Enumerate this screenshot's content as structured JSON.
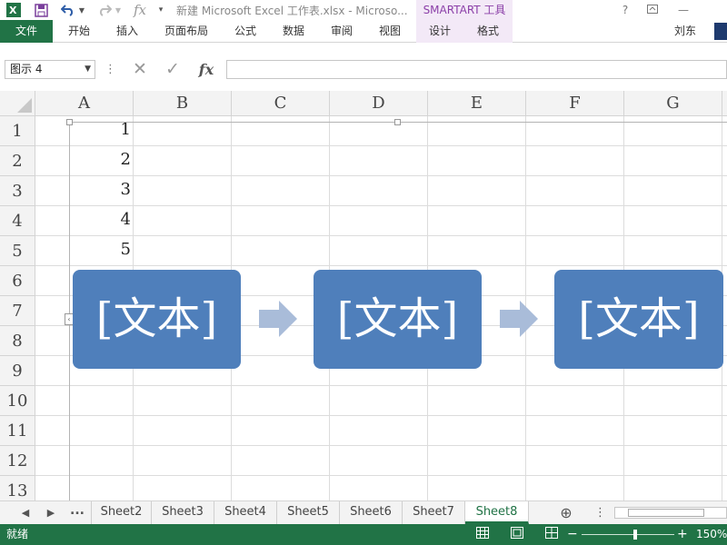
{
  "titlebar": {
    "title": "新建 Microsoft Excel 工作表.xlsx - Microso...",
    "context_group": "SMARTART 工具",
    "icons": [
      "excel-logo-icon",
      "save-icon",
      "undo-icon",
      "redo-icon",
      "fx-icon",
      "customize-qat-icon",
      "help-icon",
      "ribbon-display-icon",
      "minimize-icon"
    ]
  },
  "ribbon": {
    "file_tab": "文件",
    "tabs": [
      "开始",
      "插入",
      "页面布局",
      "公式",
      "数据",
      "审阅",
      "视图"
    ],
    "context_tabs": [
      "设计",
      "格式"
    ],
    "user": "刘东"
  },
  "formula_bar": {
    "name_box": "图示 4",
    "formula_value": ""
  },
  "sheet": {
    "columns": [
      "A",
      "B",
      "C",
      "D",
      "E",
      "F",
      "G"
    ],
    "rows": [
      "1",
      "2",
      "3",
      "4",
      "5",
      "6",
      "7",
      "8",
      "9",
      "10",
      "11",
      "12",
      "13"
    ],
    "a_values": [
      "1",
      "2",
      "3",
      "4",
      "5"
    ]
  },
  "smartart": {
    "box_texts": [
      "[文本]",
      "[文本]",
      "[文本]"
    ],
    "box_color": "#4f7fbb",
    "arrow_color": "#a9bcd9"
  },
  "tabs": {
    "ellipsis": "...",
    "sheets": [
      "Sheet2",
      "Sheet3",
      "Sheet4",
      "Sheet5",
      "Sheet6",
      "Sheet7",
      "Sheet8"
    ],
    "active": "Sheet8"
  },
  "status": {
    "text": "就绪",
    "zoom": "150%",
    "accent": "#217346"
  }
}
